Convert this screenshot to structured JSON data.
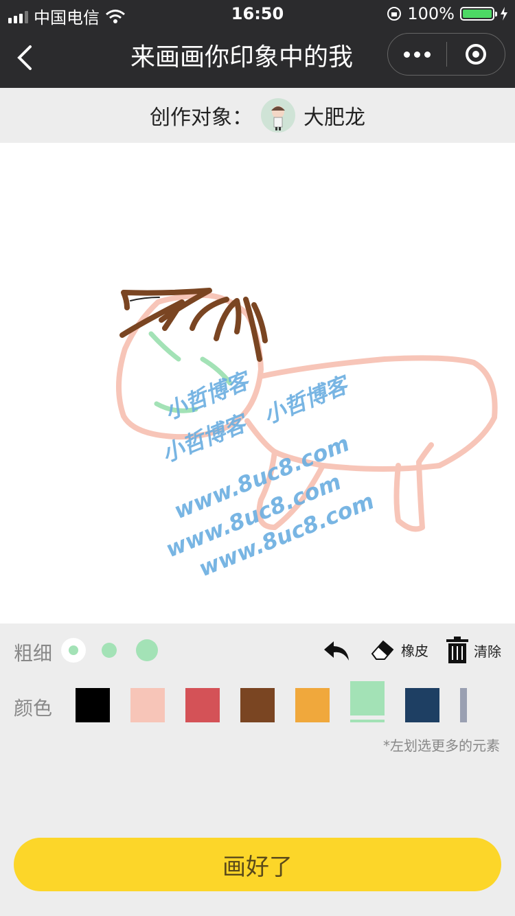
{
  "status_bar": {
    "carrier": "中国电信",
    "time": "16:50",
    "battery": "100%"
  },
  "nav": {
    "title": "来画画你印象中的我"
  },
  "subject": {
    "label": "创作对象：",
    "name": "大肥龙"
  },
  "watermark": {
    "line1": "小哲博客",
    "line2": "小哲博客",
    "line3": "小哲博客",
    "url1": "www.8uc8.com",
    "url2": "www.8uc8.com",
    "url3": "www.8uc8.com"
  },
  "toolbar": {
    "thickness_label": "粗细",
    "color_label": "颜色",
    "eraser_label": "橡皮",
    "clear_label": "清除",
    "hint": "*左划选更多的元素",
    "selected_thickness": "small",
    "selected_color": "#a3e2b6",
    "colors": [
      "#000000",
      "#f7c5b8",
      "#d45257",
      "#7a4522",
      "#f0a83c",
      "#a3e2b6",
      "#1e3f63",
      "#9aa0b2"
    ]
  },
  "submit_label": "画好了",
  "icons": [
    "back-icon",
    "more-icon",
    "target-icon",
    "undo-icon",
    "eraser-icon",
    "trash-icon",
    "wifi-icon",
    "lock-rotation-icon",
    "charging-icon"
  ]
}
